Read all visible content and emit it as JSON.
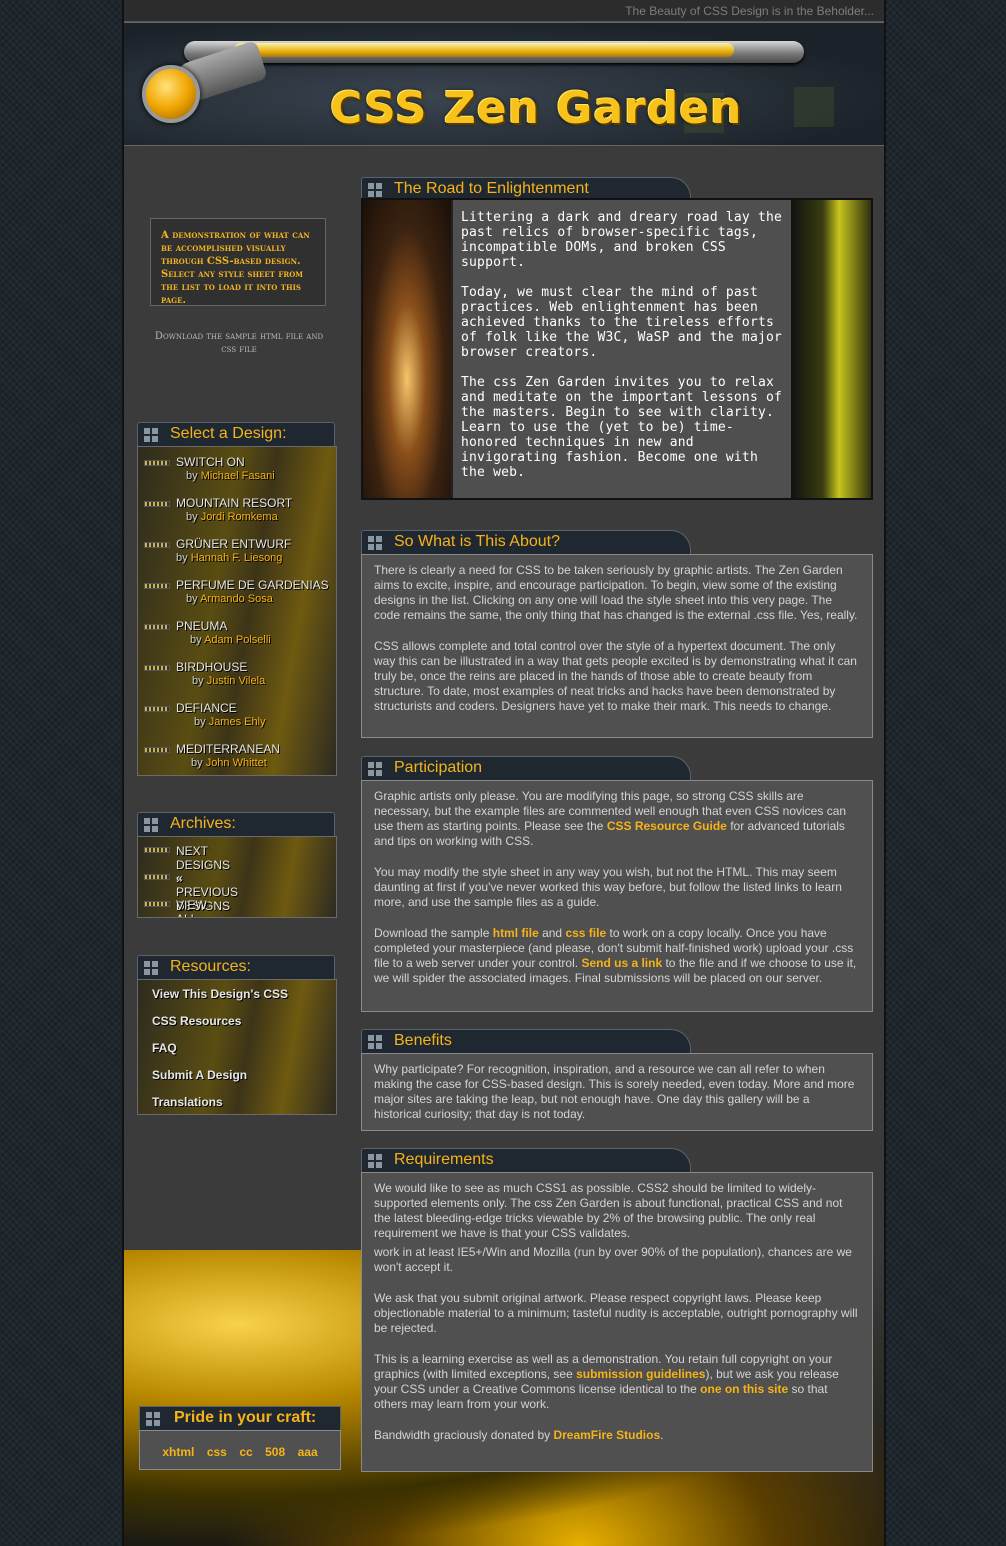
{
  "tagline": "The Beauty of CSS Design is in the Beholder...",
  "site_title": "CSS Zen Garden",
  "intro": "A demonstration of what can be accomplished visually through CSS-based design. Select any style sheet from the list to load it into this page.",
  "download_note": "Download the sample html file and css file",
  "select": {
    "title": "Select a Design:",
    "designs": [
      {
        "name": "SWITCH ON",
        "by": "by",
        "author": "Michael Fasani"
      },
      {
        "name": "MOUNTAIN RESORT",
        "by": "by",
        "author": "Jordi Romkema"
      },
      {
        "name": "GRÜNER ENTWURF",
        "by": "by",
        "author": "Hannah F. Liesong"
      },
      {
        "name": "PERFUME DE GARDENIAS",
        "by": "by",
        "author": "Armando Sosa"
      },
      {
        "name": "PNEUMA",
        "by": "by",
        "author": "Adam Polselli"
      },
      {
        "name": "BIRDHOUSE",
        "by": "by",
        "author": "Justin Vilela"
      },
      {
        "name": "DEFIANCE",
        "by": "by",
        "author": "James Ehly"
      },
      {
        "name": "MEDITERRANEAN",
        "by": "by",
        "author": "John Whittet"
      }
    ]
  },
  "archives": {
    "title": "Archives:",
    "items": [
      "NEXT DESIGNS »",
      "« PREVIOUS DESIGNS",
      "VIEW ALL DESIGNS"
    ]
  },
  "resources": {
    "title": "Resources:",
    "items": [
      "View This Design's CSS",
      "CSS Resources",
      "FAQ",
      "Submit A Design",
      "Translations"
    ]
  },
  "road": {
    "title": "The Road to Enlightenment",
    "p1": "Littering a dark and dreary road lay the past relics of browser-specific tags, incompatible DOMs, and broken CSS support.",
    "p2": "Today, we must clear the mind of past practices. Web enlightenment has been achieved thanks to the tireless efforts of folk like the W3C, WaSP and the major browser creators.",
    "p3": "The css Zen Garden invites you to relax and meditate on the important lessons of the masters. Begin to see with clarity. Learn to use the (yet to be) time-honored techniques in new and invigorating fashion. Become one with the web."
  },
  "about": {
    "title": "So What is This About?",
    "p1": "There is clearly a need for CSS to be taken seriously by graphic artists. The Zen Garden aims to excite, inspire, and encourage participation. To begin, view some of the existing designs in the list. Clicking on any one will load the style sheet into this very page. The code remains the same, the only thing that has changed is the external .css file. Yes, really.",
    "p2": "CSS allows complete and total control over the style of a hypertext document. The only way this can be illustrated in a way that gets people excited is by demonstrating what it can truly be, once the reins are placed in the hands of those able to create beauty from structure. To date, most examples of neat tricks and hacks have been demonstrated by structurists and coders. Designers have yet to make their mark. This needs to change."
  },
  "participation": {
    "title": "Participation",
    "p1a": "Graphic artists only please. You are modifying this page, so strong CSS skills are necessary, but the example files are commented well enough that even CSS novices can use them as starting points. Please see the ",
    "p1link": "CSS Resource Guide",
    "p1b": " for advanced tutorials and tips on working with CSS.",
    "p2": "You may modify the style sheet in any way you wish, but not the HTML. This may seem daunting at first if you've never worked this way before, but follow the listed links to learn more, and use the sample files as a guide.",
    "p3a": "Download the sample ",
    "p3link1": "html file",
    "p3b": " and ",
    "p3link2": "css file",
    "p3c": " to work on a copy locally. Once you have completed your masterpiece (and please, don't submit half-finished work) upload your .css file to a web server under your control. ",
    "p3link3": "Send us a link",
    "p3d": " to the file and if we choose to use it, we will spider the associated images. Final submissions will be placed on our server."
  },
  "benefits": {
    "title": "Benefits",
    "p1": "Why participate? For recognition, inspiration, and a resource we can all refer to when making the case for CSS-based design. This is sorely needed, even today. More and more major sites are taking the leap, but not enough have. One day this gallery will be a historical curiosity; that day is not today."
  },
  "requirements": {
    "title": "Requirements",
    "p1": "We would like to see as much CSS1 as possible. CSS2 should be limited to widely-supported elements only. The css Zen Garden is about functional, practical CSS and not the latest bleeding-edge tricks viewable by 2% of the browsing public. The only real requirement we have is that your CSS validates.",
    "p2": "work in at least IE5+/Win and Mozilla (run by over 90% of the population), chances are we won't accept it.",
    "p3": "We ask that you submit original artwork. Please respect copyright laws. Please keep objectionable material to a minimum; tasteful nudity is acceptable, outright pornography will be rejected.",
    "p4a": "This is a learning exercise as well as a demonstration. You retain full copyright on your graphics (with limited exceptions, see ",
    "p4link1": "submission guidelines",
    "p4b": "), but we ask you release your CSS under a Creative Commons license identical to the ",
    "p4link2": "one on this site",
    "p4c": " so that others may learn from your work.",
    "p5a": "Bandwidth graciously donated by ",
    "p5link": "DreamFire Studios",
    "p5b": "."
  },
  "pride": {
    "title": "Pride in your craft:",
    "links": [
      "xhtml",
      "css",
      "cc",
      "508",
      "aaa"
    ]
  }
}
